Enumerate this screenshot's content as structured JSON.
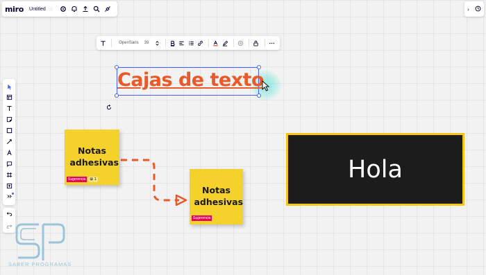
{
  "app": {
    "logo": "miro",
    "board_title": "Untitled"
  },
  "topbar": {
    "icons": [
      "gear-icon",
      "bell-icon",
      "upload-icon",
      "search-icon",
      "plug-icon"
    ]
  },
  "topright": {
    "icons": [
      "expand-icon",
      "timer-icon"
    ]
  },
  "format_toolbar": {
    "font": "OpenSans",
    "size": "39",
    "text_color": "#e85a29"
  },
  "left_toolbar": {
    "tools": [
      "select-tool",
      "templates-tool",
      "text-tool",
      "sticky-note-tool",
      "shape-tool",
      "pen-tool",
      "connector-tool",
      "comment-tool",
      "frame-tool",
      "upload-tool",
      "more-tools"
    ]
  },
  "canvas": {
    "title_text": "Cajas de texto",
    "sticky_1": {
      "text": "Notas adhesivas",
      "tag": "Sugerencia",
      "emoji": "😀 1"
    },
    "sticky_2": {
      "text": "Notas adhesivas",
      "tag": "Sugerencia"
    },
    "box_text": "Hola",
    "accent_color": "#e85a29",
    "sticky_color": "#f5d12b"
  },
  "watermark": {
    "text": "SABER PROGRAMAS"
  }
}
